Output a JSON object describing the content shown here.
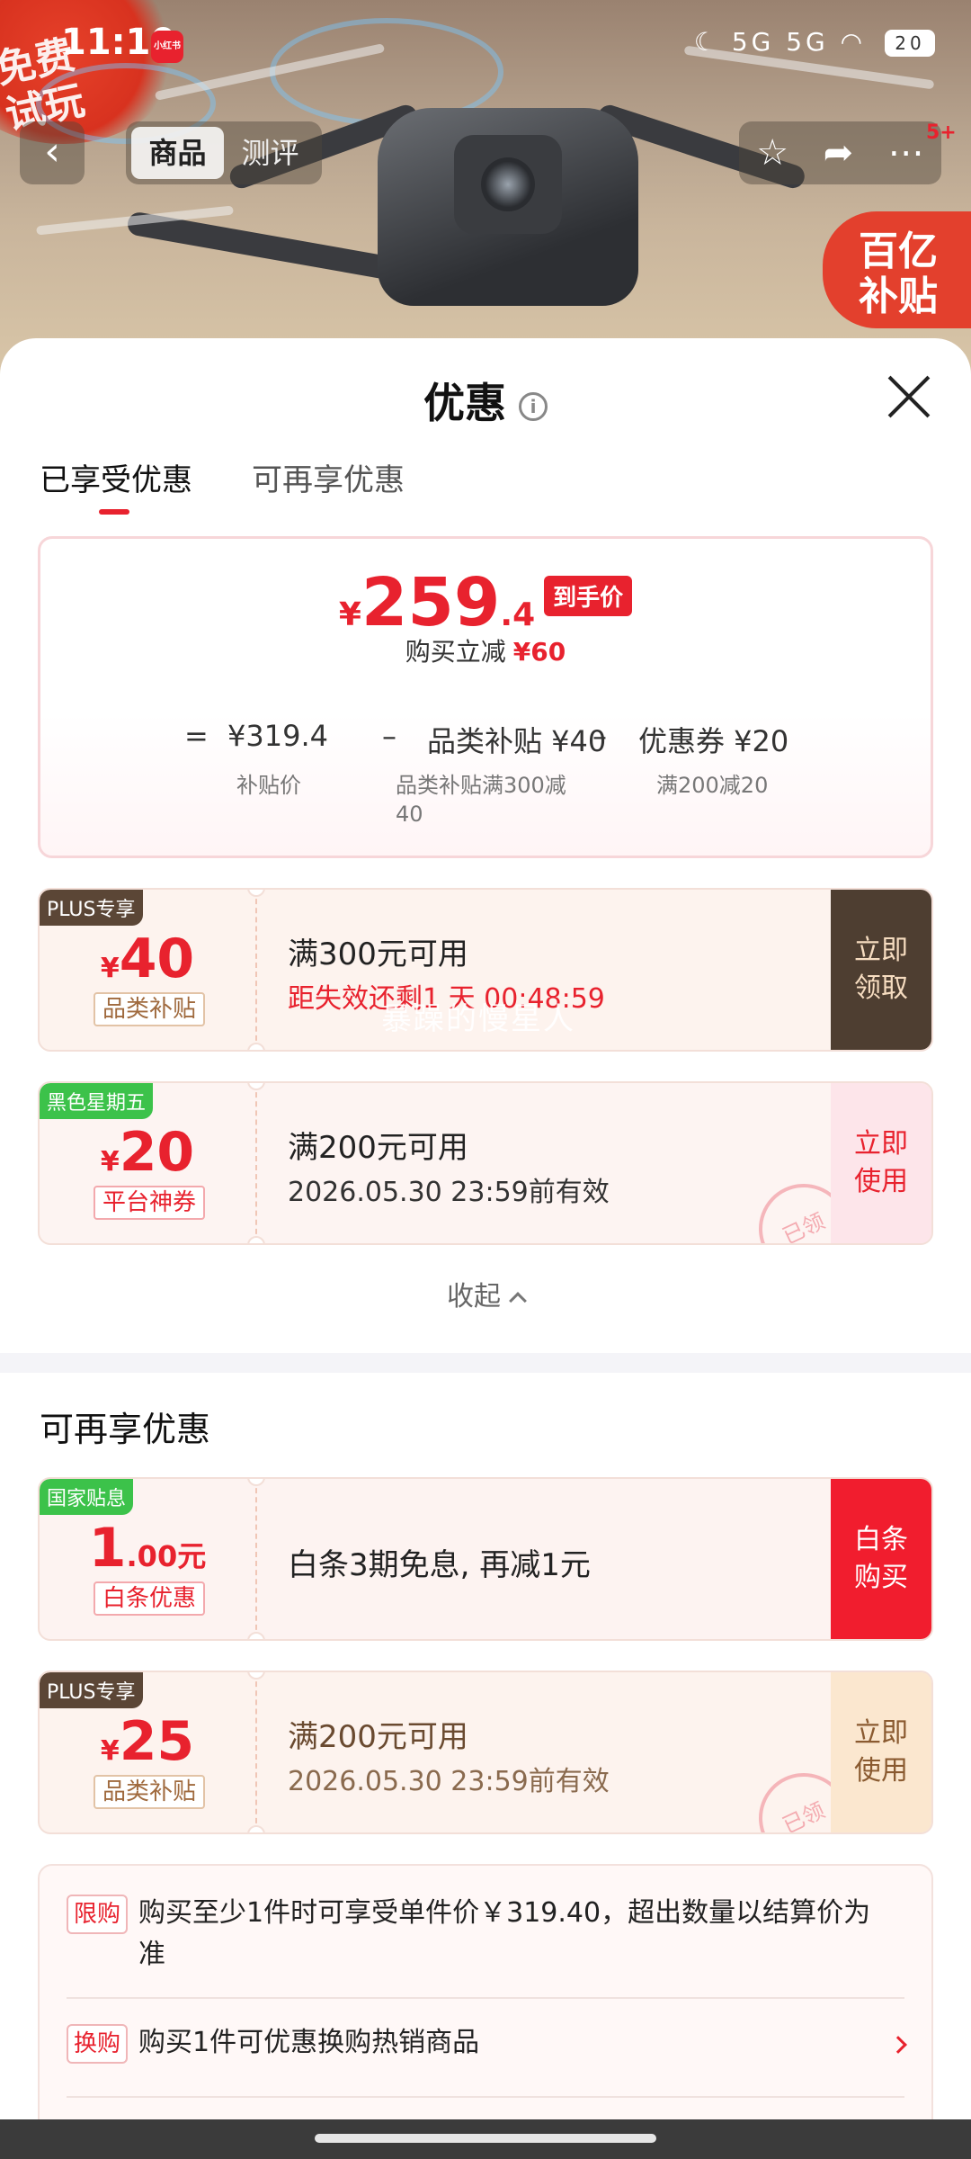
{
  "status_bar": {
    "time": "11:10",
    "app_icon_text": "小红书",
    "signal": "5G 5G",
    "battery": "20"
  },
  "hero": {
    "free_badge": "免费\n试玩",
    "subsidy_badge": "百亿\n补贴"
  },
  "nav": {
    "back": "‹",
    "tabs": [
      "商品",
      "测评"
    ],
    "active_tab": "商品",
    "more_count": "5+"
  },
  "sheet": {
    "title": "优惠",
    "info_icon": "i",
    "tabs": [
      "已享受优惠",
      "可再享优惠"
    ],
    "active_tab": "已享受优惠"
  },
  "price_summary": {
    "currency": "¥",
    "price_int": "259",
    "price_dec": ".4",
    "price_tag": "到手价",
    "reduce_label": "购买立减",
    "reduce_amount": "¥60",
    "formula": {
      "eq": "=",
      "base": "¥319.4",
      "minus1": "–",
      "part1": "品类补贴 ¥40",
      "minus2": "–",
      "part2": "优惠券 ¥20",
      "base_label": "补贴价",
      "part1_label": "品类补贴满300减\n40",
      "part2_label": "满200减20"
    }
  },
  "applied_coupons": [
    {
      "ribbon": "PLUS专享",
      "ribbon_color": "#5b4636",
      "currency": "¥",
      "amount": "40",
      "kind": "品类补贴",
      "condition": "满300元可用",
      "subtext": "距失效还剩1 天 00:48:59",
      "action": "立即\n领取",
      "watermark": "暴躁的慢星人"
    },
    {
      "ribbon": "黑色星期五",
      "ribbon_color": "#3cc24a",
      "currency": "¥",
      "amount": "20",
      "kind": "平台神券",
      "condition": "满200元可用",
      "subtext": "2026.05.30 23:59前有效",
      "action": "立即\n使用",
      "stamp": "已领"
    }
  ],
  "collapse_label": "收起",
  "more_section": {
    "title": "可再享优惠",
    "coupons": [
      {
        "ribbon": "国家贴息",
        "ribbon_color": "#3cc24a",
        "amount": "1",
        "amount_dec": ".00元",
        "kind": "白条优惠",
        "condition": "白条3期免息, 再减1元",
        "action": "白条\n购买"
      },
      {
        "ribbon": "PLUS专享",
        "ribbon_color": "#5b4636",
        "currency": "¥",
        "amount": "25",
        "kind": "品类补贴",
        "condition": "满200元可用",
        "subtext": "2026.05.30 23:59前有效",
        "action": "立即\n使用",
        "stamp": "已领"
      }
    ]
  },
  "rules": [
    {
      "tag": "限购",
      "text": "购买至少1件时可享受单件价￥319.40，超出数量以结算价为准"
    },
    {
      "tag": "换购",
      "text": "购买1件可优惠换购热销商品"
    }
  ],
  "colors": {
    "accent": "#e8222e",
    "plus_dark": "#4e3e31",
    "ticket_bg": "#fdf3ee"
  }
}
